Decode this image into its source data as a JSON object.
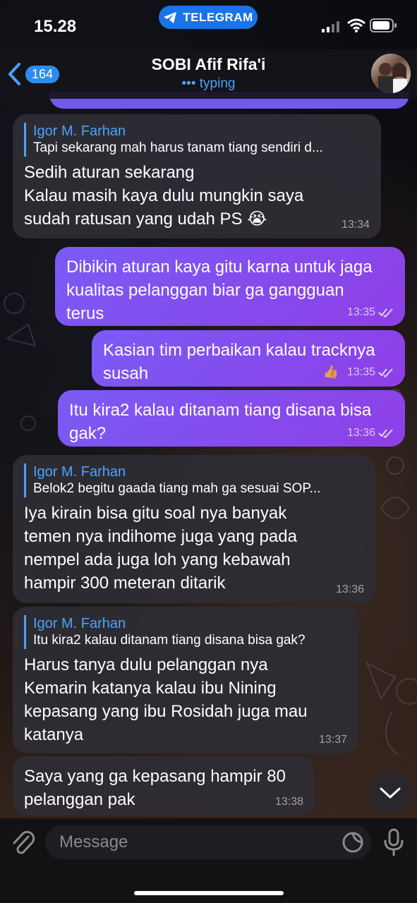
{
  "status_bar": {
    "time": "15.28",
    "app_pill": "TELEGRAM"
  },
  "header": {
    "unread_count": "164",
    "title": "SOBI Afif Rifa'i",
    "status": "typing"
  },
  "messages": [
    {
      "direction": "incoming",
      "reply_name": "Igor M. Farhan",
      "reply_text": "Tapi sekarang mah harus tanam tiang sendiri d...",
      "text": "Sedih aturan sekarang\nKalau masih kaya dulu mungkin saya\nsudah ratusan yang udah PS 😭",
      "time": "13:34"
    },
    {
      "direction": "outgoing",
      "text": "Dibikin aturan kaya gitu karna untuk jaga\nkualitas pelanggan biar ga gangguan\nterus",
      "time": "13:35"
    },
    {
      "direction": "outgoing",
      "text": "Kasian tim perbaikan kalau tracknya\nsusah",
      "time": "13:35",
      "reaction": "👍"
    },
    {
      "direction": "outgoing",
      "text": "Itu kira2 kalau ditanam tiang disana bisa\ngak?",
      "time": "13:36"
    },
    {
      "direction": "incoming",
      "reply_name": "Igor M. Farhan",
      "reply_text": "Belok2 begitu gaada tiang mah ga sesuai SOP...",
      "text": "Iya kirain bisa gitu soal nya banyak\ntemen nya indihome juga yang pada\nnempel ada juga loh yang kebawah\nhampir 300 meteran ditarik",
      "time": "13:36"
    },
    {
      "direction": "incoming",
      "reply_name": "Igor M. Farhan",
      "reply_text": "Itu kira2 kalau ditanam tiang disana bisa gak?",
      "text": "Harus tanya dulu pelanggan nya\nKemarin katanya kalau ibu Nining\nkepasang yang ibu Rosidah juga mau\nkatanya",
      "time": "13:37"
    },
    {
      "direction": "incoming",
      "text": "Saya yang ga kepasang hampir 80\npelanggan pak",
      "time": "13:38"
    }
  ],
  "composer": {
    "placeholder": "Message"
  },
  "colors": {
    "accent": "#4aa3ff",
    "outgoing": "#7a5bf5",
    "pill": "#1a73e8"
  }
}
